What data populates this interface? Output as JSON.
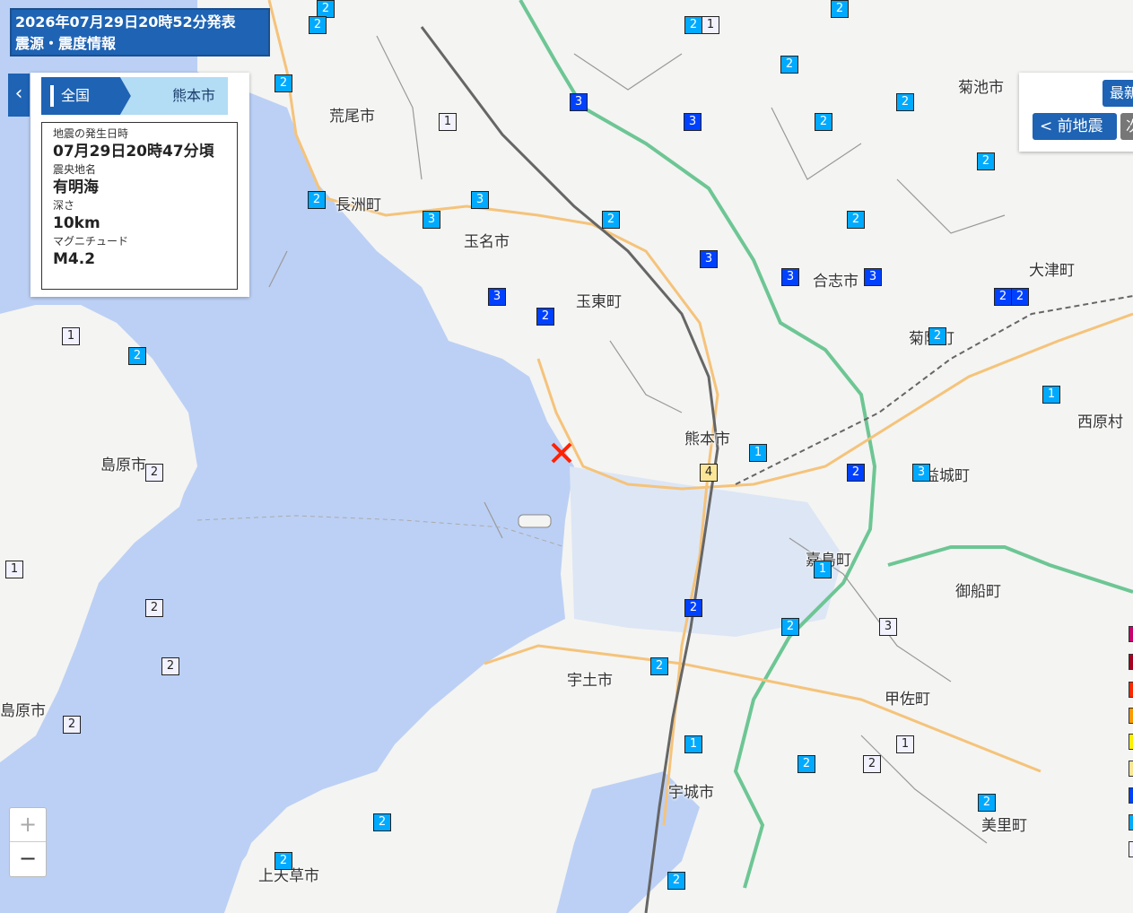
{
  "header": {
    "issued": "2026年07月29日20時52分発表",
    "title": "震源・震度情報"
  },
  "breadcrumb": {
    "level1": "全国",
    "level2": "熊本市"
  },
  "quake": {
    "time_label": "地震の発生日時",
    "time_value": "07月29日20時47分頃",
    "area_label": "震央地名",
    "area_value": "有明海",
    "depth_label": "深さ",
    "depth_value": "10km",
    "mag_label": "マグニチュード",
    "mag_value": "M4.2"
  },
  "nav": {
    "latest_label": "最新",
    "prev_label": "< 前地震",
    "next_label": "次"
  },
  "zoom": {
    "in_label": "+",
    "out_label": "−"
  },
  "colors": {
    "sea": "#bcd0f5",
    "land": "#f4f4f2",
    "int1": "#f2f2ff",
    "int2": "#00aaff",
    "int3": "#0041ff",
    "int4": "#fae696",
    "expressway": "#6dc694",
    "road": "#f5c37a",
    "brand": "#1e63b4"
  },
  "places": [
    "荒尾市",
    "長洲町",
    "玉名市",
    "玉東町",
    "熊本市",
    "宇土市",
    "宇城市",
    "上天草市",
    "島原市",
    "島原市",
    "菊池市",
    "合志市",
    "菊陽町",
    "大津町",
    "西原村",
    "益城町",
    "嘉島町",
    "御船町",
    "甲佐町",
    "美里町"
  ],
  "intensities": [
    "2",
    "2",
    "2",
    "1",
    "2",
    "2",
    "3",
    "3",
    "2",
    "1",
    "2",
    "2",
    "2",
    "2",
    "3",
    "3",
    "2",
    "2",
    "3",
    "3",
    "3",
    "3",
    "1",
    "2",
    "2",
    "2",
    "2",
    "2",
    "1",
    "2",
    "1",
    "1",
    "2",
    "4",
    "2",
    "3",
    "2",
    "1",
    "2",
    "2",
    "3",
    "2",
    "2",
    "1",
    "1",
    "2",
    "2",
    "2",
    "2",
    "2"
  ],
  "legend": {
    "colors": [
      "#c8006e",
      "#a50021",
      "#ff2800",
      "#ff9900",
      "#fff000",
      "#fae696",
      "#0041ff",
      "#00aaff",
      "#f2f2ff"
    ]
  },
  "epicenter": "epicenter-marker"
}
